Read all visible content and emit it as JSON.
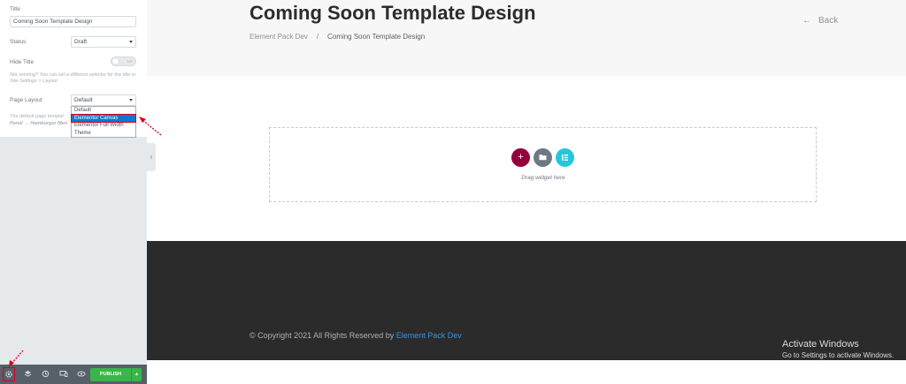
{
  "panel": {
    "title_label": "Title",
    "title_value": "Coming Soon Template Design",
    "status_label": "Status",
    "status_value": "Draft",
    "hide_title_label": "Hide Title",
    "hide_title_toggle": "NO",
    "hide_title_note": "Not working? You can set a different selector for the title in Site Settings > Layout",
    "page_layout_label": "Page Layout",
    "page_layout_value": "Default",
    "page_layout_note_partial": "The default page templat",
    "page_layout_note_partial2": "Panel → Hamburger Men",
    "page_layout_options": [
      "Default",
      "Elementor Canvas",
      "Elementor Full Width",
      "Theme"
    ],
    "highlighted_option": "Elementor Canvas"
  },
  "toolbar": {
    "icons": [
      "gear-icon",
      "layers-icon",
      "history-icon",
      "responsive-icon",
      "eye-icon"
    ],
    "publish_label": "PUBLISH"
  },
  "preview": {
    "page_title": "Coming Soon Template Design",
    "breadcrumb_home": "Element Pack Dev",
    "breadcrumb_sep": "/",
    "breadcrumb_current": "Coming Soon Template Design",
    "back_label": "Back",
    "dropzone_text": "Drag widget here",
    "copyright_text": "© Copyright 2021 All Rights Reserved by ",
    "copyright_link": "Element Pack Dev"
  },
  "windows": {
    "line1": "Activate Windows",
    "line2": "Go to Settings to activate Windows."
  },
  "colors": {
    "accent_red": "#93003c",
    "add_button": "#93003c",
    "template_button": "#6d7882",
    "elementor_button": "#26c6da",
    "publish_green": "#39b54a",
    "footer_bg": "#2b2b2b",
    "annotation_red": "#d7001e"
  }
}
